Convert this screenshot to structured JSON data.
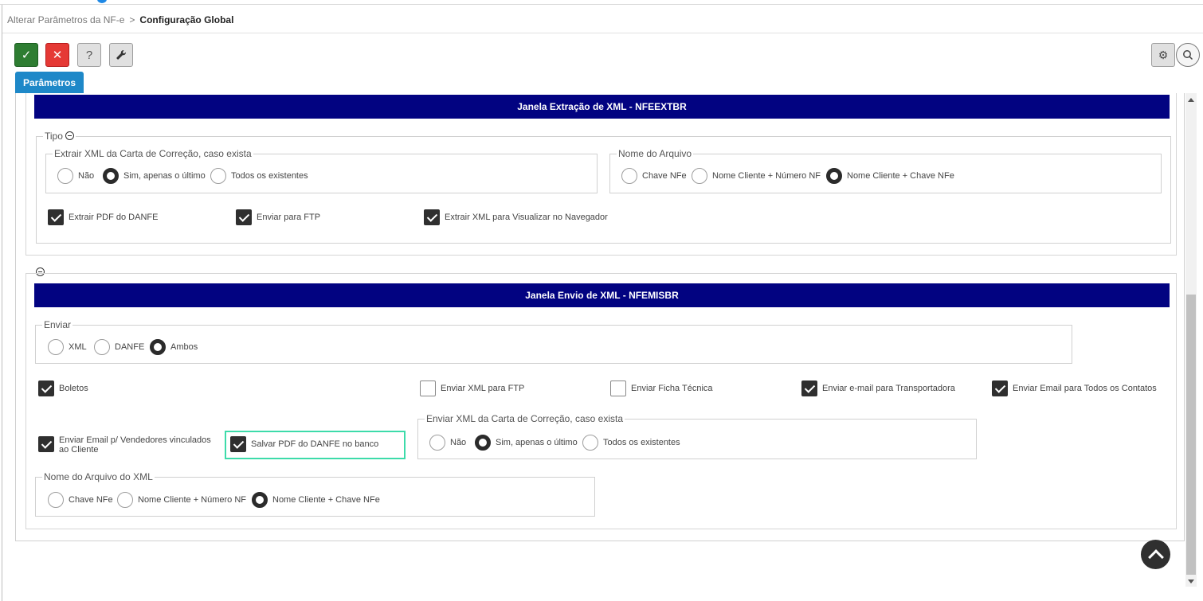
{
  "breadcrumb": {
    "parent": "Alterar Parâmetros da NF-e",
    "separator": ">",
    "current": "Configuração Global"
  },
  "toolbar": {
    "confirm": "✓",
    "cancel": "✕",
    "help": "?",
    "tools": "🔧",
    "settings": "⚙"
  },
  "tab": {
    "label": "Parâmetros"
  },
  "section1": {
    "title": "Janela Extração de XML - NFEEXTBR",
    "tipo_legend": "Tipo",
    "carta_legend": "Extrair XML da Carta de Correção, caso exista",
    "carta_options": [
      "Não",
      "Sim, apenas o último",
      "Todos os existentes"
    ],
    "carta_selected": "Sim, apenas o último",
    "nome_legend": "Nome do Arquivo",
    "nome_options": [
      "Chave NFe",
      "Nome Cliente + Número NF",
      "Nome Cliente + Chave NFe"
    ],
    "nome_selected": "Nome Cliente + Chave NFe",
    "checks": [
      {
        "label": "Extrair PDF do DANFE",
        "checked": true
      },
      {
        "label": "Enviar para FTP",
        "checked": true
      },
      {
        "label": "Extrair XML para Visualizar no Navegador",
        "checked": true
      }
    ]
  },
  "section2": {
    "title": "Janela Envio de XML - NFEMISBR",
    "enviar_legend": "Enviar",
    "enviar_options": [
      "XML",
      "DANFE",
      "Ambos"
    ],
    "enviar_selected": "Ambos",
    "checks_row1": [
      {
        "label": "Boletos",
        "checked": true
      },
      {
        "label": "Enviar XML para FTP",
        "checked": false
      },
      {
        "label": "Enviar Ficha Técnica",
        "checked": false
      },
      {
        "label": "Enviar e-mail para Transportadora",
        "checked": true
      },
      {
        "label": "Enviar Email para Todos os Contatos",
        "checked": true
      }
    ],
    "check_vendedores": {
      "label": "Enviar Email p/ Vendedores vinculados ao Cliente",
      "checked": true
    },
    "check_salvar_pdf": {
      "label": "Salvar PDF do DANFE no banco",
      "checked": true
    },
    "carta_legend": "Enviar XML da Carta de Correção, caso exista",
    "carta_options": [
      "Não",
      "Sim, apenas o último",
      "Todos os existentes"
    ],
    "carta_selected": "Sim, apenas o último",
    "nome_legend": "Nome do Arquivo do XML",
    "nome_options": [
      "Chave NFe",
      "Nome Cliente + Número NF",
      "Nome Cliente + Chave NFe"
    ],
    "nome_selected": "Nome Cliente + Chave NFe"
  },
  "icons": {
    "collapse": "minus-circle-icon",
    "search": "search-icon",
    "back_to_top": "chevron-up-icon"
  }
}
